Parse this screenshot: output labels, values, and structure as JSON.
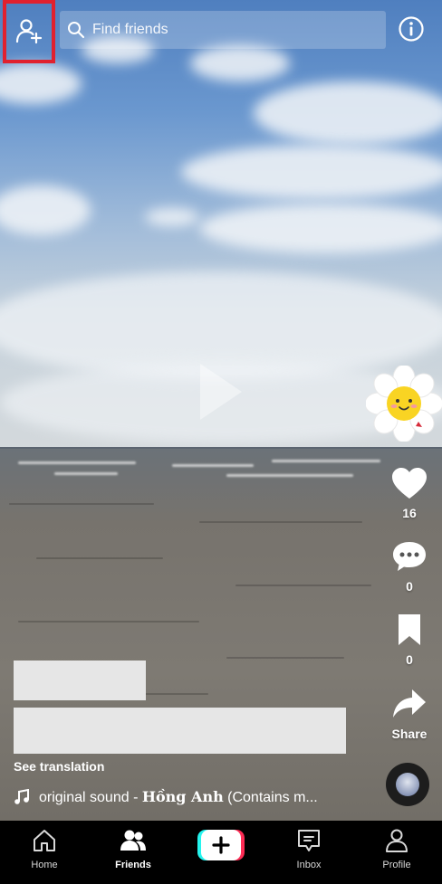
{
  "header": {
    "search_placeholder": "Find friends"
  },
  "actions": {
    "like_count": "16",
    "comment_count": "0",
    "bookmark_count": "0",
    "share_label": "Share"
  },
  "caption": {
    "see_translation": "See translation",
    "sound_prefix": "original sound - ",
    "sound_author": "Hồng Anh",
    "sound_suffix": " (Contains m..."
  },
  "nav": {
    "home": "Home",
    "friends": "Friends",
    "inbox": "Inbox",
    "profile": "Profile",
    "active": "friends"
  },
  "colors": {
    "highlight_border": "#e0212f",
    "create_left": "#25f4ee",
    "create_right": "#fe2c55"
  }
}
